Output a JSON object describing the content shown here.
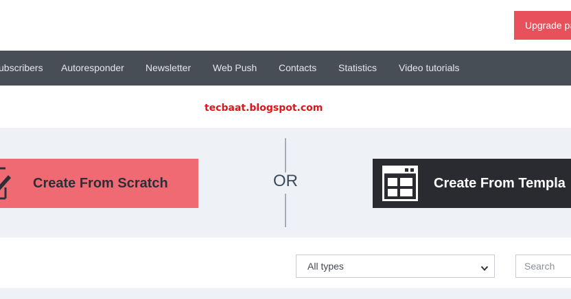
{
  "header": {
    "upgrade_label": "Upgrade pa"
  },
  "nav": {
    "items": [
      {
        "label": "ubscribers"
      },
      {
        "label": "Autoresponder"
      },
      {
        "label": "Newsletter"
      },
      {
        "label": "Web Push"
      },
      {
        "label": "Contacts"
      },
      {
        "label": "Statistics"
      },
      {
        "label": "Video tutorials"
      }
    ]
  },
  "watermark": "tecbaat.blogspot.com",
  "create": {
    "scratch_label": "Create From Scratch",
    "or_label": "OR",
    "template_label": "Create From Templa"
  },
  "filters": {
    "type_selected": "All types",
    "search_placeholder": "Search"
  },
  "colors": {
    "upgrade": "#e8505b",
    "navbar": "#474e56",
    "scratch_button": "#f06a74",
    "template_button": "#2a2b30",
    "watermark": "#e0141c"
  },
  "icons": {
    "scratch": "pencil-edit-icon",
    "template": "template-grid-icon",
    "select": "chevron-down-icon"
  }
}
